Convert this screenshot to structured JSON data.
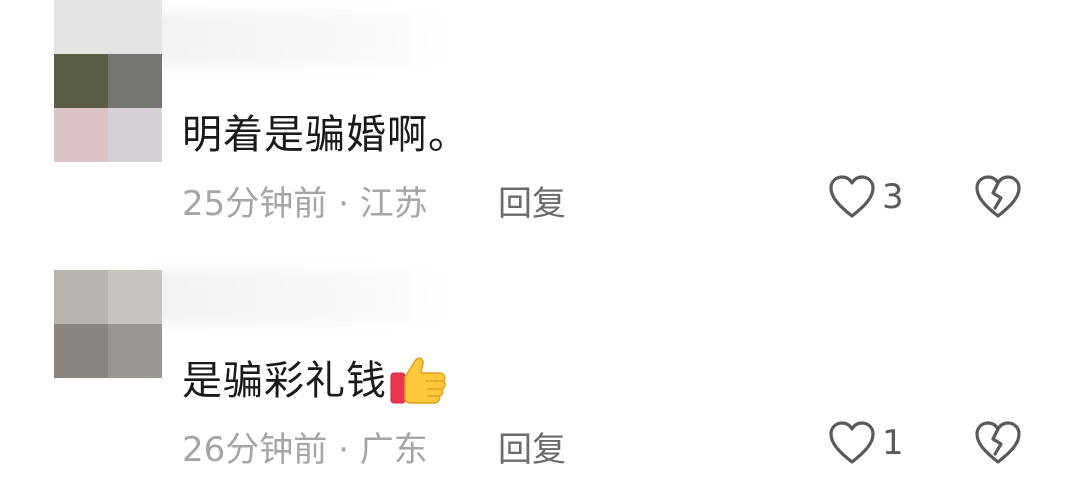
{
  "comments": [
    {
      "text": "明着是骗婚啊。",
      "time": "25分钟前",
      "separator": " · ",
      "location": "江苏",
      "reply_label": "回复",
      "like_count": "3",
      "like_icon": "heart-outline-icon",
      "dislike_icon": "broken-heart-icon"
    },
    {
      "text": "是骗彩礼钱",
      "emoji": "thumbs-up",
      "time": "26分钟前",
      "separator": " · ",
      "location": "广东",
      "reply_label": "回复",
      "like_count": "1",
      "like_icon": "heart-outline-icon",
      "dislike_icon": "broken-heart-icon"
    }
  ],
  "colors": {
    "text": "#1a1a1a",
    "meta": "#a5a5a5",
    "reply": "#6b6b6b",
    "icon": "#5a5a5a"
  }
}
